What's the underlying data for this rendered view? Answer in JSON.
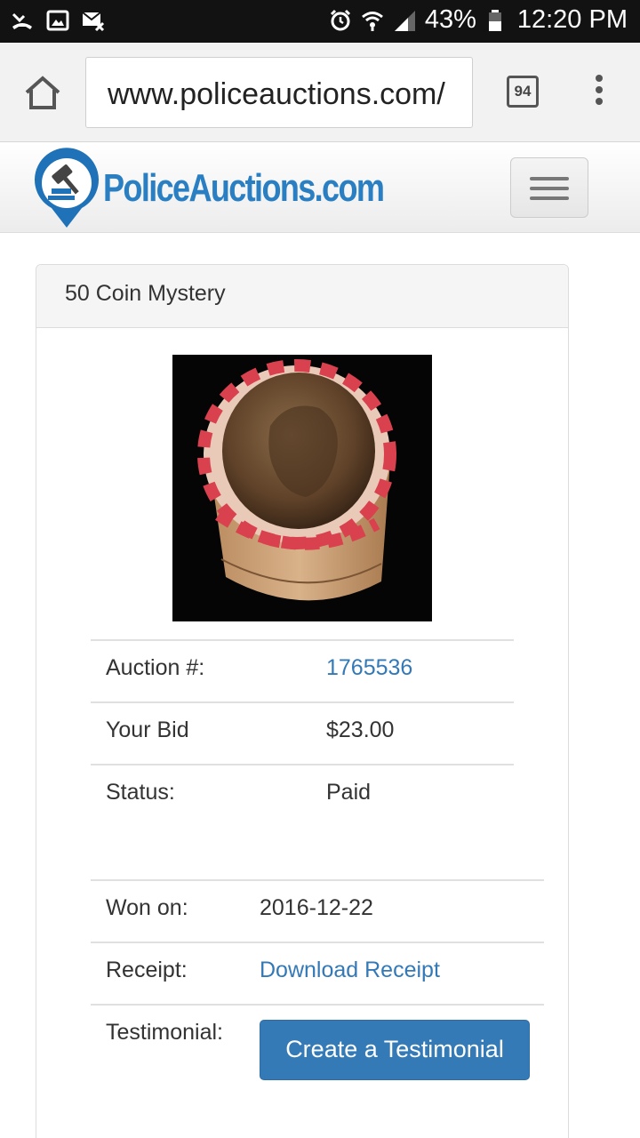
{
  "status_bar": {
    "battery": "43%",
    "time": "12:20 PM"
  },
  "browser": {
    "url": "www.policeauctions.com/",
    "tab_count": "94"
  },
  "site": {
    "logo_text": "PoliceAuctions.com",
    "brand_color": "#2a7fc3"
  },
  "item": {
    "title": "50 Coin Mystery",
    "image_alt": "coin roll"
  },
  "details": [
    {
      "label": "Auction #:",
      "value": "1765536"
    },
    {
      "label": "Your Bid",
      "value": "$23.00"
    },
    {
      "label": "Status:",
      "value": "Paid"
    }
  ],
  "order": {
    "won_on_label": "Won on:",
    "won_on_value": "2016-12-22",
    "receipt_label": "Receipt:",
    "receipt_link": "Download Receipt",
    "testimonial_label": "Testimonial:",
    "testimonial_button": "Create a Testimonial"
  },
  "colors": {
    "link": "#3379b7",
    "button": "#337ab7"
  }
}
